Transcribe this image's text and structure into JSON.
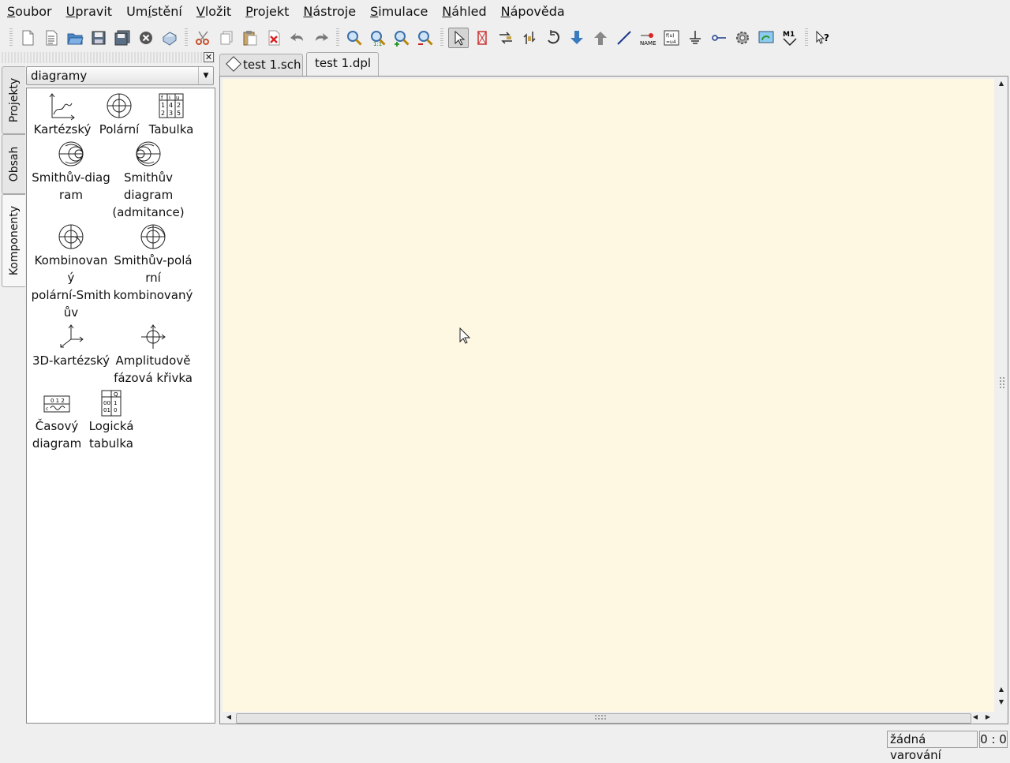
{
  "menu": [
    {
      "key": "S",
      "rest": "oubor"
    },
    {
      "key": "U",
      "rest": "pravit"
    },
    {
      "pre": "Um",
      "key": "í",
      "rest": "stění"
    },
    {
      "key": "V",
      "rest": "ložit"
    },
    {
      "key": "P",
      "rest": "rojekt"
    },
    {
      "key": "N",
      "rest": "ástroje"
    },
    {
      "key": "S",
      "rest": "imulace"
    },
    {
      "key": "N",
      "rest": "áhled"
    },
    {
      "key": "N",
      "rest": "ápověda"
    }
  ],
  "toolbar_icons": [
    "new-file",
    "new-text",
    "open",
    "save",
    "save-all",
    "close",
    "print",
    "cut",
    "copy",
    "paste",
    "delete",
    "undo",
    "redo",
    "zoom-fit",
    "zoom-1-1",
    "zoom-in",
    "zoom-out",
    "select",
    "deactivate",
    "mirror-x",
    "mirror-y",
    "rotate",
    "move-down",
    "move-up",
    "wire",
    "wire-label",
    "equation",
    "ground",
    "port",
    "simulate",
    "view-data",
    "marker",
    "whats-this"
  ],
  "dock": {
    "close_glyph": "✕",
    "side_tabs": [
      "Projekty",
      "Obsah",
      "Komponenty"
    ],
    "category": "diagramy",
    "components": [
      {
        "name": "Kartézský",
        "icon": "cartesian-diagram-icon"
      },
      {
        "name": "Polární",
        "icon": "polar-diagram-icon"
      },
      {
        "name": "Tabulka",
        "icon": "tabular-icon"
      },
      {
        "name": "Smithův-diag ram",
        "lines": [
          "Smithův-diag",
          "ram"
        ],
        "icon": "smith-chart-icon"
      },
      {
        "name": "Smithův diagram (admitance)",
        "lines": [
          "Smithův",
          "diagram",
          "(admitance)"
        ],
        "icon": "admittance-smith-icon"
      },
      {
        "name": "Kombinovaný polární-Smithův",
        "lines": [
          "Kombinovan",
          "ý",
          "polární-Smith",
          "ův"
        ],
        "icon": "polar-smith-icon"
      },
      {
        "name": "Smithův-polární kombinovaný",
        "lines": [
          "Smithův-polá",
          "rní",
          "kombinovaný"
        ],
        "icon": "smith-polar-icon"
      },
      {
        "name": "3D-kartézský",
        "lines": [
          "3D-kartézský"
        ],
        "icon": "3d-cartesian-icon"
      },
      {
        "name": "Amplitudově fázová křivka",
        "lines": [
          "Amplitudově",
          "fázová křivka"
        ],
        "icon": "locus-curve-icon"
      },
      {
        "name": "Časový diagram",
        "lines": [
          "Časový",
          "diagram"
        ],
        "icon": "timing-diagram-icon"
      },
      {
        "name": "Logická tabulka",
        "lines": [
          "Logická",
          "tabulka"
        ],
        "icon": "truth-table-icon"
      }
    ]
  },
  "tabs": [
    {
      "label": "test 1.sch",
      "icon": "schematic-icon"
    },
    {
      "label": "test 1.dpl",
      "icon": ""
    }
  ],
  "canvas_color": "#fef8e2",
  "status": {
    "warnings": "žádná varování",
    "position": "0 : 0"
  }
}
